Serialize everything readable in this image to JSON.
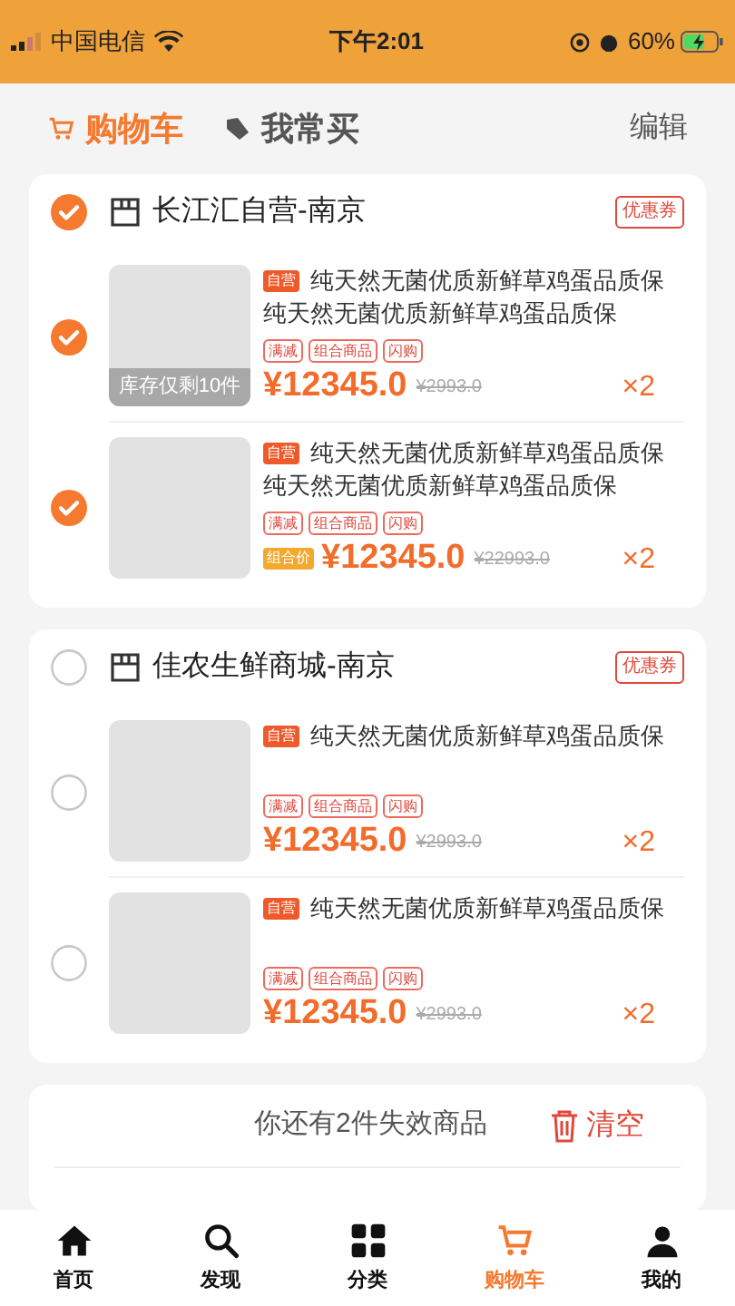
{
  "status_bar": {
    "carrier": "中国电信",
    "time": "下午2:01",
    "battery": "60%"
  },
  "header": {
    "tabs": [
      {
        "label": "购物车",
        "selected": true
      },
      {
        "label": "我常买",
        "selected": false
      }
    ],
    "edit": "编辑"
  },
  "stores": [
    {
      "name": "长江汇自营-南京",
      "checked": true,
      "coupon": "优惠券",
      "items": [
        {
          "checked": true,
          "badge": "自营",
          "title_lines": [
            "纯天然无菌优质新鲜草鸡蛋品质保",
            "纯天然无菌优质新鲜草鸡蛋品质保"
          ],
          "tags": [
            "满减",
            "组合商品",
            "闪购"
          ],
          "stock": "库存仅剩10件",
          "price": "¥12345.0",
          "original_price": "¥2993.0",
          "quantity": "×2"
        },
        {
          "checked": true,
          "badge": "自营",
          "title_lines": [
            "纯天然无菌优质新鲜草鸡蛋品质保",
            "纯天然无菌优质新鲜草鸡蛋品质保"
          ],
          "tags": [
            "满减",
            "组合商品",
            "闪购"
          ],
          "price_tag": "组合价",
          "price": "¥12345.0",
          "original_price": "¥22993.0",
          "quantity": "×2"
        }
      ]
    },
    {
      "name": "佳农生鲜商城-南京",
      "checked": false,
      "coupon": "优惠券",
      "items": [
        {
          "checked": false,
          "badge": "自营",
          "title_lines": [
            "纯天然无菌优质新鲜草鸡蛋品质保"
          ],
          "tags": [
            "满减",
            "组合商品",
            "闪购"
          ],
          "price": "¥12345.0",
          "original_price": "¥2993.0",
          "quantity": "×2"
        },
        {
          "checked": false,
          "badge": "自营",
          "title_lines": [
            "纯天然无菌优质新鲜草鸡蛋品质保"
          ],
          "tags": [
            "满减",
            "组合商品",
            "闪购"
          ],
          "price": "¥12345.0",
          "original_price": "¥2993.0",
          "quantity": "×2"
        }
      ]
    }
  ],
  "invalid": {
    "message": "你还有2件失效商品",
    "clear": "清空"
  },
  "tab_bar": [
    {
      "kind": "home",
      "label": "首页",
      "selected": false
    },
    {
      "kind": "discover",
      "label": "发现",
      "selected": false
    },
    {
      "kind": "category",
      "label": "分类",
      "selected": false
    },
    {
      "kind": "cart",
      "label": "购物车",
      "selected": true
    },
    {
      "kind": "mine",
      "label": "我的",
      "selected": false
    }
  ]
}
